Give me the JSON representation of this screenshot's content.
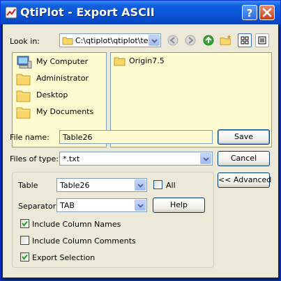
{
  "window": {
    "title": "QtiPlot - Export ASCII"
  },
  "look_in": {
    "label": "Look in:",
    "path": "C:\\qtiplot\\qtiplot\\test",
    "places": [
      {
        "label": "My Computer",
        "icon": "computer-icon"
      },
      {
        "label": "Administrator",
        "icon": "folder-icon"
      },
      {
        "label": "Desktop",
        "icon": "folder-icon"
      },
      {
        "label": "My Documents",
        "icon": "folder-icon"
      }
    ],
    "files": [
      {
        "label": "Origin7.5",
        "icon": "folder-icon"
      }
    ]
  },
  "toolbar_icons": [
    "back-icon",
    "forward-icon",
    "up-icon",
    "new-folder-icon",
    "list-view-icon",
    "detail-view-icon"
  ],
  "file_name": {
    "label": "File name:",
    "value": "Table26"
  },
  "files_of_type": {
    "label": "Files of type:",
    "value": "*.txt"
  },
  "buttons": {
    "save": "Save",
    "cancel": "Cancel",
    "advanced": "<< Advanced",
    "help": "Help"
  },
  "options": {
    "table_label": "Table",
    "table_value": "Table26",
    "all_label": "All",
    "all_checked": false,
    "separator_label": "Separator",
    "separator_value": "TAB",
    "include_names_label": "Include Column Names",
    "include_names_checked": true,
    "include_comments_label": "Include Column Comments",
    "include_comments_checked": false,
    "export_selection_label": "Export Selection",
    "export_selection_checked": true
  }
}
